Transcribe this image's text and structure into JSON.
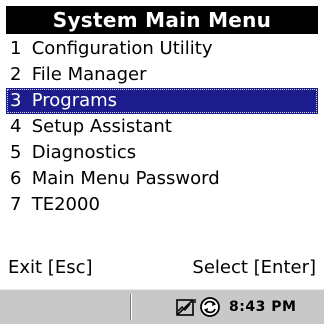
{
  "title": "System Main Menu",
  "menu": {
    "items": [
      {
        "num": "1",
        "label": "Configuration Utility"
      },
      {
        "num": "2",
        "label": "File Manager"
      },
      {
        "num": "3",
        "label": "Programs"
      },
      {
        "num": "4",
        "label": "Setup Assistant"
      },
      {
        "num": "5",
        "label": "Diagnostics"
      },
      {
        "num": "6",
        "label": "Main Menu Password"
      },
      {
        "num": "7",
        "label": "TE2000"
      }
    ],
    "selected_index": 2
  },
  "footer": {
    "exit_label": "Exit [Esc]",
    "select_label": "Select [Enter]"
  },
  "taskbar": {
    "icons": [
      "no-network-icon",
      "sync-icon"
    ],
    "clock": "8:43 PM"
  },
  "colors": {
    "title_bg": "#000000",
    "selection_bg": "#1c1c8c",
    "taskbar_bg": "#c8c8c8"
  }
}
